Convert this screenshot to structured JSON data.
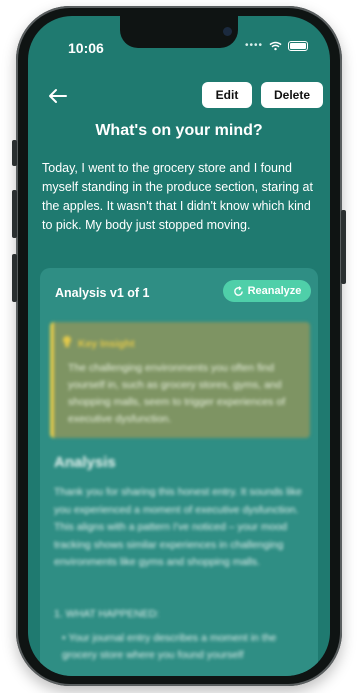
{
  "status_bar": {
    "time": "10:06"
  },
  "toolbar": {
    "edit_label": "Edit",
    "delete_label": "Delete"
  },
  "page": {
    "title": "What's on your mind?",
    "entry_text": "Today, I went to the grocery store and I found myself standing in the produce section, staring at the apples. It wasn't that I didn't know which kind to pick.  My body just stopped moving."
  },
  "analysis": {
    "version_label": "Analysis v1 of 1",
    "reanalyze_label": "Reanalyze",
    "key_insight_title": "Key Insight",
    "key_insight_text": "The challenging environments you often find yourself in, such as grocery stores, gyms, and shopping malls, seem to trigger experiences of executive dysfunction.",
    "section_title": "Analysis",
    "body": "Thank you for sharing this honest entry. It sounds like you experienced a moment of executive dysfunction. This aligns with a pattern I've noticed – your mood tracking shows similar experiences in challenging environments like gyms and shopping malls.",
    "subsection_title": "1. WHAT HAPPENED:",
    "subsection_text": "• Your journal entry describes a moment in the grocery store where you found yourself"
  },
  "colors": {
    "background": "#1f7a70",
    "card": "#2f8e84",
    "accent": "#4fcfa9",
    "insight": "#7e9463",
    "insight_border": "#e3c94a"
  }
}
